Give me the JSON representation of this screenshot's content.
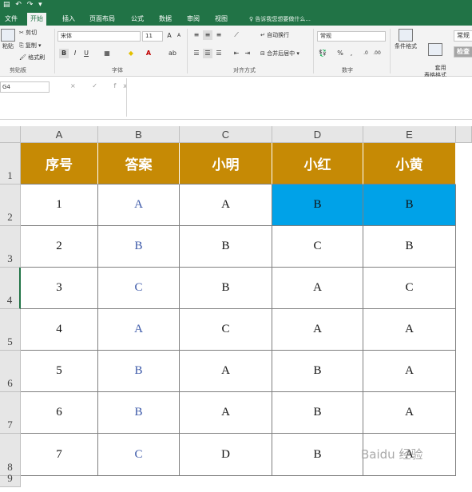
{
  "titlebar": {
    "quick_access": "▤ ↶ ↷ ▾"
  },
  "tabs": [
    "文件",
    "开始",
    "插入",
    "页面布局",
    "公式",
    "数据",
    "审阅",
    "视图"
  ],
  "active_tab_index": 1,
  "tell_me": "♀ 告诉我您想要做什么...",
  "ribbon": {
    "clipboard": {
      "paste": "粘贴",
      "cut": "剪切",
      "copy": "复制 ▾",
      "format_painter": "格式刷",
      "label": "剪贴板"
    },
    "font": {
      "name": "宋体",
      "size": "11",
      "label": "字体",
      "bold": "B",
      "italic": "I",
      "underline": "U"
    },
    "alignment": {
      "wrap": "自动换行",
      "merge": "合并后居中 ▾",
      "label": "对齐方式"
    },
    "number": {
      "format": "常规",
      "label": "数字",
      "percent": "%",
      "comma": ","
    },
    "styles": {
      "conditional": "条件格式",
      "table": "套用\n表格格式",
      "normal": "常规",
      "check": "检查"
    }
  },
  "formula_bar": {
    "name_box": "G4",
    "icons": "× ✓ fx",
    "content": ""
  },
  "columns": [
    "A",
    "B",
    "C",
    "D",
    "E"
  ],
  "rows": [
    "1",
    "2",
    "3",
    "4",
    "5",
    "6",
    "7",
    "8",
    "9"
  ],
  "table": {
    "headers": [
      "序号",
      "答案",
      "小明",
      "小红",
      "小黄"
    ],
    "data": [
      [
        "1",
        "A",
        "A",
        "B",
        "B"
      ],
      [
        "2",
        "B",
        "B",
        "C",
        "B"
      ],
      [
        "3",
        "C",
        "B",
        "A",
        "C"
      ],
      [
        "4",
        "A",
        "C",
        "A",
        "A"
      ],
      [
        "5",
        "B",
        "A",
        "B",
        "A"
      ],
      [
        "6",
        "B",
        "A",
        "B",
        "A"
      ],
      [
        "7",
        "C",
        "D",
        "B",
        "A"
      ]
    ]
  },
  "highlight_cells": [
    "D2",
    "E2"
  ],
  "colors": {
    "excel_green": "#217346",
    "header_fill": "#c68a05",
    "highlight": "#00a2e8",
    "answer_blue": "#3b58a8"
  },
  "watermark": "Baidu 经验"
}
